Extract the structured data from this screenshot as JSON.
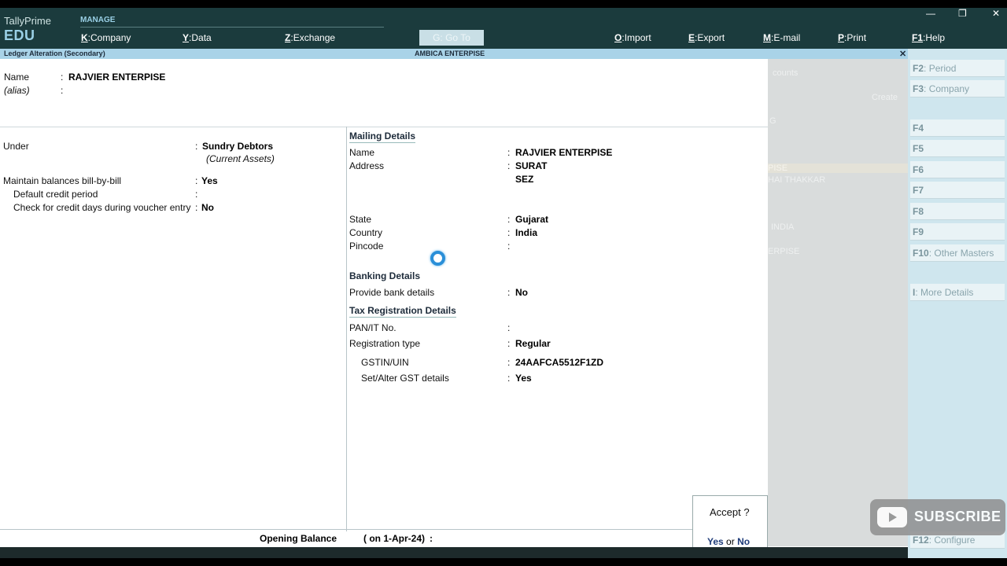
{
  "brand": {
    "name": "TallyPrime",
    "edition": "EDU"
  },
  "topbar": {
    "manage_label": "MANAGE",
    "menu": [
      {
        "key": "K",
        "label": "Company"
      },
      {
        "key": "Y",
        "label": "Data"
      },
      {
        "key": "Z",
        "label": "Exchange"
      },
      {
        "key": "O",
        "label": "Import"
      },
      {
        "key": "E",
        "label": "Export"
      },
      {
        "key": "M",
        "label": "E-mail"
      },
      {
        "key": "P",
        "label": "Print"
      },
      {
        "key": "F1",
        "label": "Help"
      }
    ],
    "goto": "G: Go To",
    "window_controls": {
      "minimize": "—",
      "restore": "❐",
      "close": "✕"
    }
  },
  "titlebar": {
    "screen": "Ledger Alteration (Secondary)",
    "company": "AMBICA ENTERPISE",
    "close": "✕"
  },
  "form": {
    "name_label": "Name",
    "name_value": "RAJVIER ENTERPISE",
    "alias_label": "(alias)",
    "under_label": "Under",
    "under_value": "Sundry Debtors",
    "under_group": "(Current Assets)",
    "billwise_label": "Maintain balances bill-by-bill",
    "billwise_value": "Yes",
    "credit_period_label": "Default credit period",
    "check_credit_label": "Check for credit days during voucher entry",
    "check_credit_value": "No",
    "opening_label": "Opening Balance",
    "opening_date": "( on 1-Apr-24)"
  },
  "mailing": {
    "title": "Mailing Details",
    "name_label": "Name",
    "name_value": "RAJVIER ENTERPISE",
    "address_label": "Address",
    "address_line1": "SURAT",
    "address_line2": "SEZ",
    "state_label": "State",
    "state_value": "Gujarat",
    "country_label": "Country",
    "country_value": "India",
    "pincode_label": "Pincode"
  },
  "banking": {
    "title": "Banking Details",
    "provide_label": "Provide bank details",
    "provide_value": "No"
  },
  "tax": {
    "title": "Tax Registration Details",
    "pan_label": "PAN/IT No.",
    "regtype_label": "Registration type",
    "regtype_value": "Regular",
    "gstin_label": "GSTIN/UIN",
    "gstin_value": "24AAFCA5512F1ZD",
    "setalter_label": "Set/Alter GST details",
    "setalter_value": "Yes"
  },
  "accept": {
    "question": "Accept ?",
    "yes": "Yes",
    "or": "or",
    "no": "No"
  },
  "background_panel": {
    "g1": "counts",
    "g2": "Create",
    "g3": "G",
    "g4": "PISE",
    "g5": "HAI THAKKAR",
    "g6": "INDIA",
    "g7": "ERPISE"
  },
  "fkeys": [
    {
      "key": "F2",
      "label": "Period"
    },
    {
      "key": "F3",
      "label": "Company"
    },
    {
      "key": "F4",
      "label": ""
    },
    {
      "key": "F5",
      "label": ""
    },
    {
      "key": "F6",
      "label": ""
    },
    {
      "key": "F7",
      "label": ""
    },
    {
      "key": "F8",
      "label": ""
    },
    {
      "key": "F9",
      "label": ""
    },
    {
      "key": "F10",
      "label": "Other Masters"
    },
    {
      "key": "I",
      "label": "More Details"
    },
    {
      "key": "F12",
      "label": "Configure"
    }
  ],
  "watermark": {
    "text": "SUBSCRIBE"
  }
}
